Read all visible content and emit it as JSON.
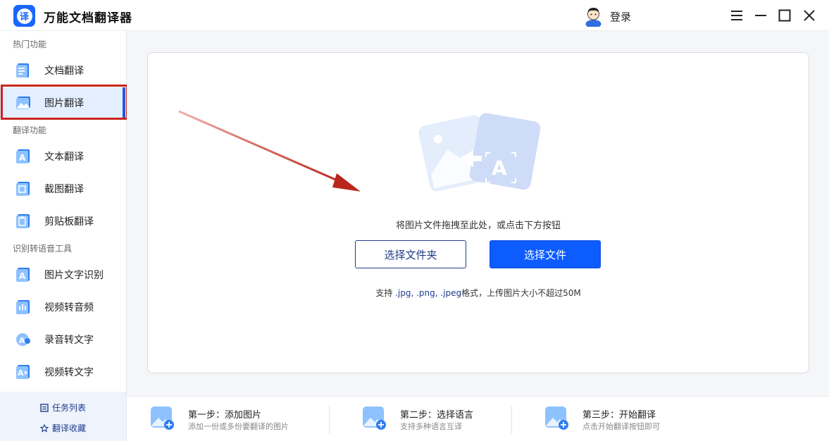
{
  "app": {
    "title": "万能文档翻译器",
    "logo_glyph": "译",
    "login_label": "登录"
  },
  "sidebar": {
    "sections": [
      {
        "label": "热门功能"
      },
      {
        "label": "翻译功能"
      },
      {
        "label": "识别转语音工具"
      }
    ],
    "items": [
      {
        "label": "文档翻译",
        "icon": "document-icon"
      },
      {
        "label": "图片翻译",
        "icon": "image-icon",
        "active": true
      },
      {
        "label": "文本翻译",
        "icon": "text-icon"
      },
      {
        "label": "截图翻译",
        "icon": "screenshot-icon"
      },
      {
        "label": "剪贴板翻译",
        "icon": "clipboard-icon"
      },
      {
        "label": "图片文字识别",
        "icon": "ocr-icon"
      },
      {
        "label": "视频转音频",
        "icon": "video-audio-icon"
      },
      {
        "label": "录音转文字",
        "icon": "audio-text-icon"
      },
      {
        "label": "视频转文字",
        "icon": "video-text-icon"
      }
    ],
    "bottom": {
      "task_list": "任务列表",
      "favorites": "翻译收藏"
    }
  },
  "main": {
    "drop_hint": "将图片文件拖拽至此处，或点击下方按钮",
    "select_folder": "选择文件夹",
    "select_file": "选择文件",
    "support_prefix": "支持",
    "support_formats": " .jpg, .png, .jpeg",
    "support_suffix": "格式，上传图片大小不超过50M"
  },
  "steps": [
    {
      "title": "第一步：添加图片",
      "desc": "添加一份或多份要翻译的图片"
    },
    {
      "title": "第二步：选择语言",
      "desc": "支持多种语言互译"
    },
    {
      "title": "第三步：开始翻译",
      "desc": "点击开始翻译按钮即可"
    }
  ],
  "colors": {
    "accent": "#0d5cff",
    "accent_dark": "#1f3c8c",
    "active_bg": "#e3efff",
    "highlight": "#c8261d"
  }
}
